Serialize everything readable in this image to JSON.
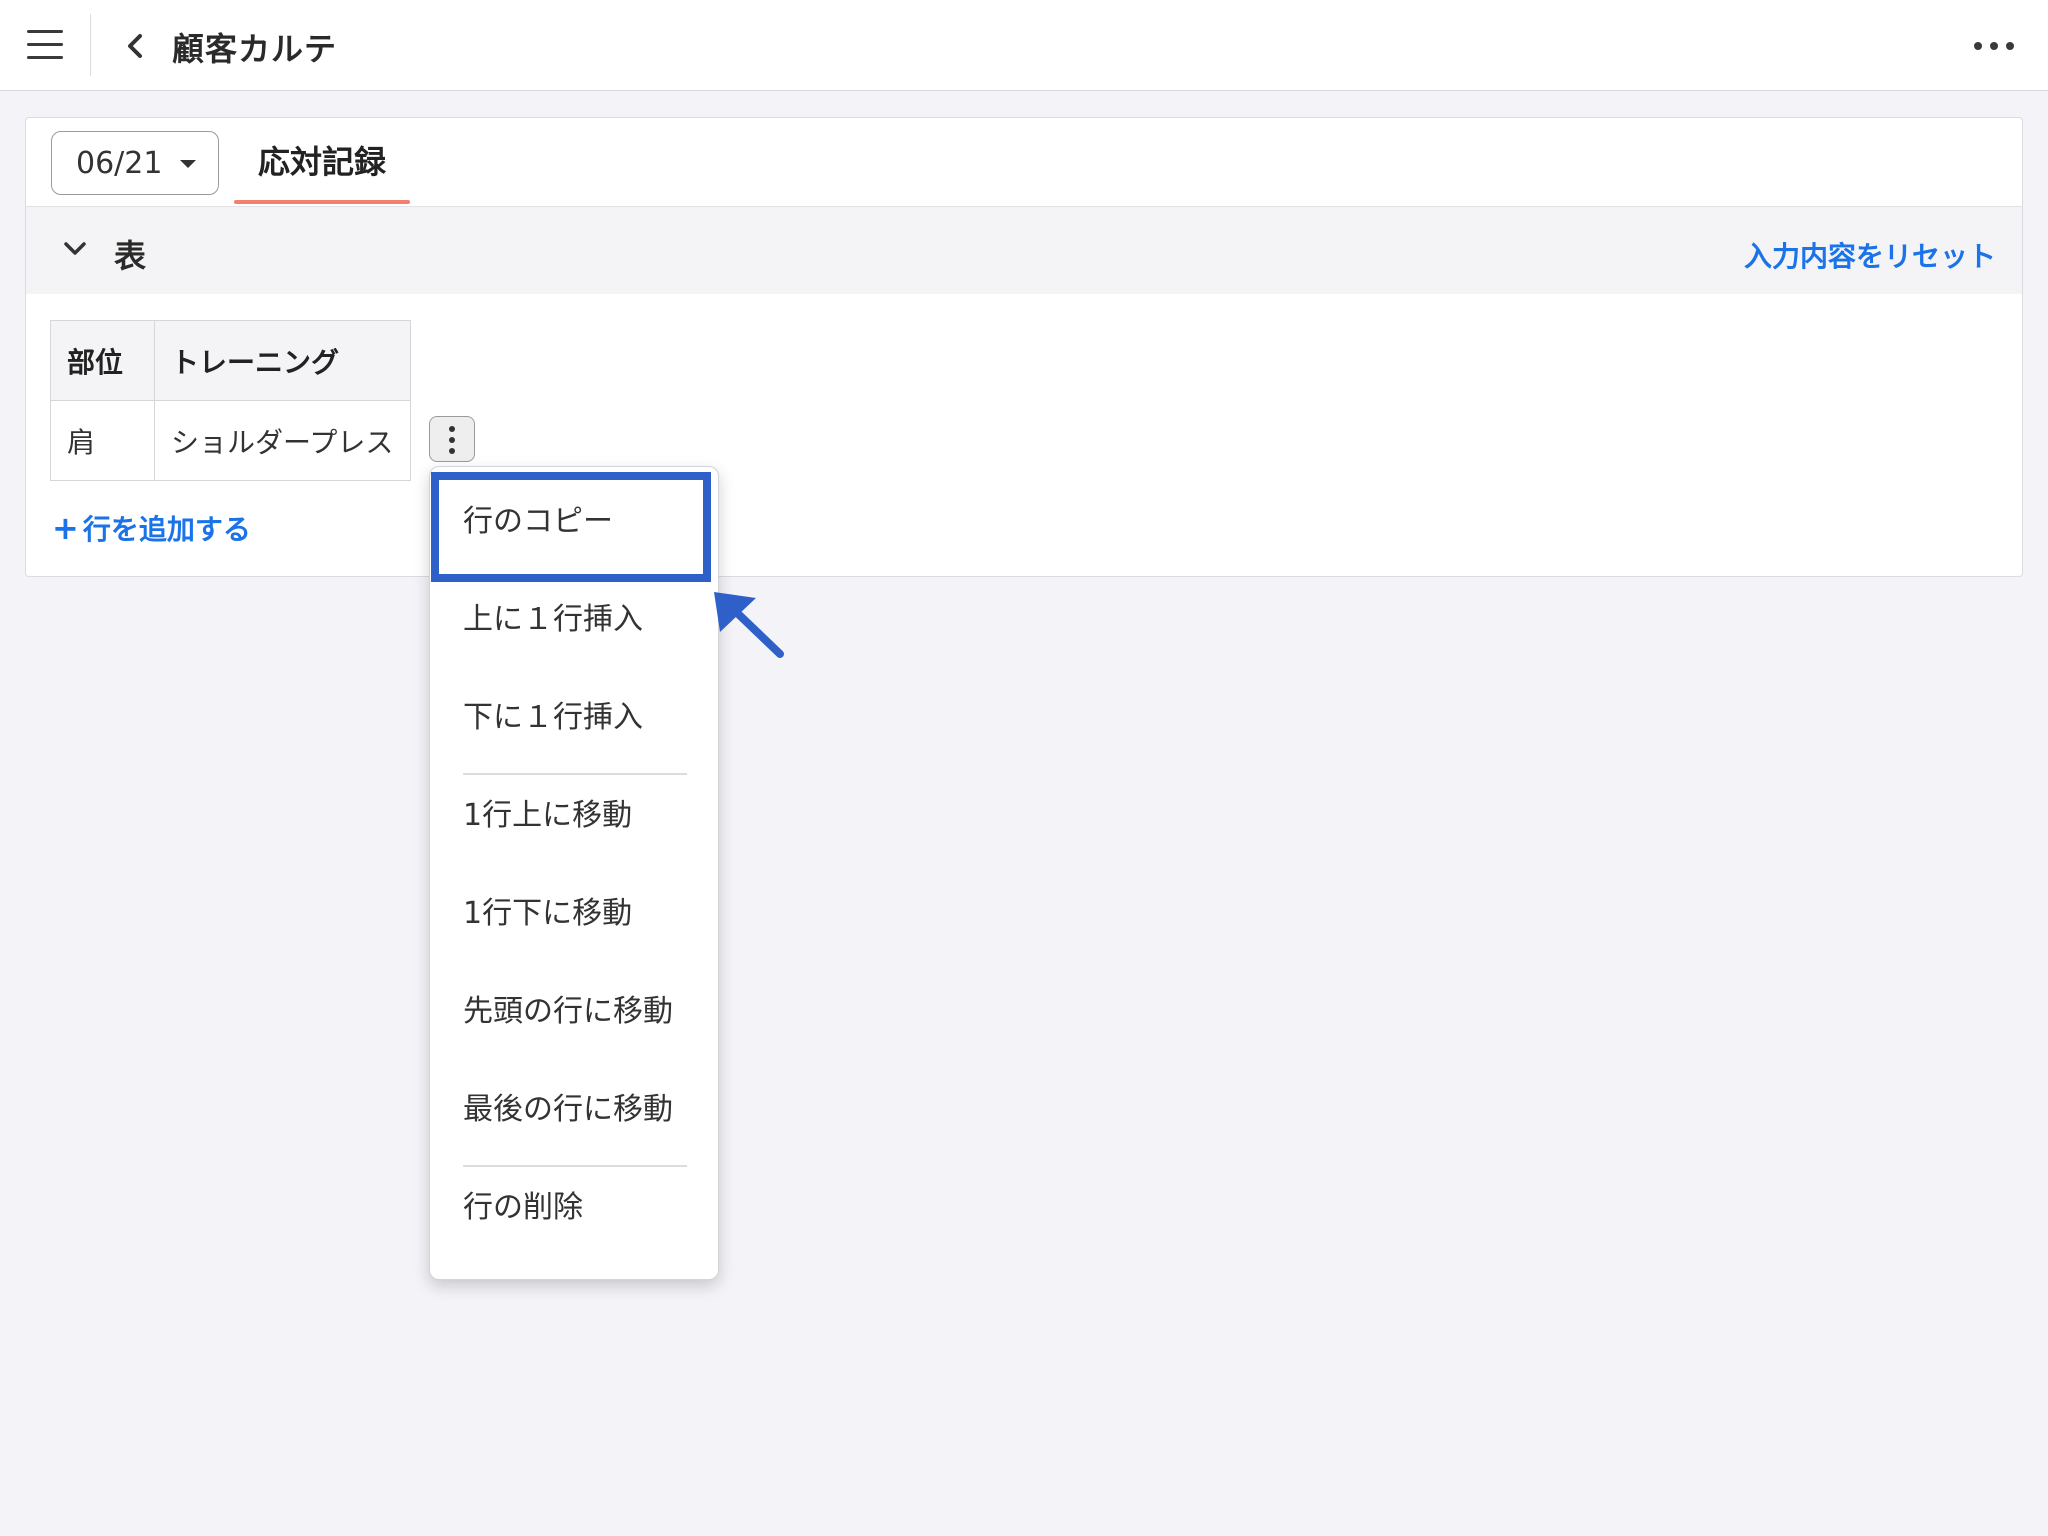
{
  "header": {
    "title": "顧客カルテ"
  },
  "form": {
    "date_value": "06/21",
    "active_tab": "応対記録"
  },
  "section": {
    "title": "表",
    "reset_label": "入力内容をリセット"
  },
  "table": {
    "columns": [
      "部位",
      "トレーニング"
    ],
    "rows": [
      {
        "part": "肩",
        "training": "ショルダープレス"
      }
    ],
    "add_row_label": "行を追加する"
  },
  "row_menu": {
    "items": [
      "行のコピー",
      "上に１行挿入",
      "下に１行挿入",
      "1行上に移動",
      "1行下に移動",
      "先頭の行に移動",
      "最後の行に移動",
      "行の削除"
    ]
  },
  "colors": {
    "accent_blue": "#1a73e8",
    "tab_underline": "#f08070",
    "highlight": "#2f5fc9"
  }
}
